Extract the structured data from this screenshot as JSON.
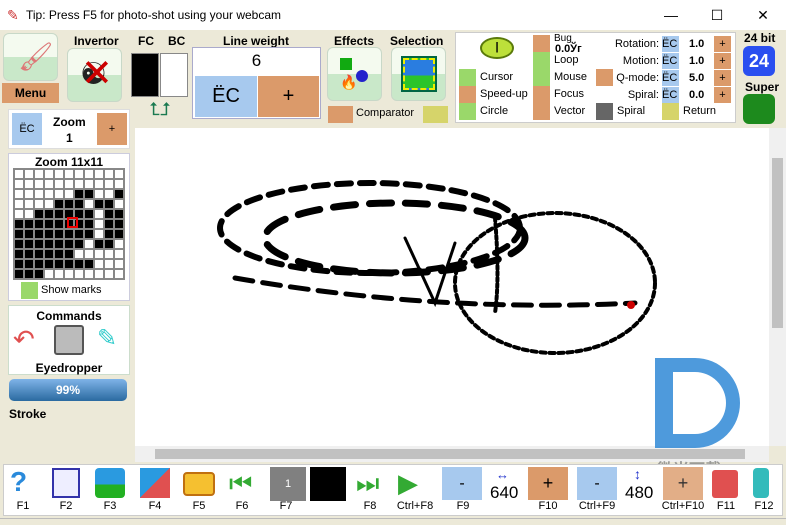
{
  "window": {
    "title": "Tip: Press F5 for photo-shot using your webcam",
    "controls": [
      "—",
      "☐",
      "✕"
    ]
  },
  "toolbar": {
    "menu": "Menu",
    "invertor": "Invertor",
    "fc": "FC",
    "bc": "BC",
    "line_weight": {
      "label": "Line weight",
      "value": "6",
      "minus": "ЁС",
      "plus": "+"
    },
    "effects": "Effects",
    "selection": "Selection",
    "comparator": "Comparator",
    "bug": "Bug",
    "bug_value": "0.0Ўг",
    "options": [
      "Cursor",
      "Speed-up",
      "Circle",
      "Loop",
      "Mouse",
      "Focus",
      "Vector",
      "Spiral",
      "Return"
    ],
    "params": [
      {
        "label": "Rotation:",
        "minus": "ЁС",
        "value": "1.0",
        "plus": "+"
      },
      {
        "label": "Motion:",
        "minus": "ЁС",
        "value": "1.0",
        "plus": "+"
      },
      {
        "label": "Q-mode:",
        "minus": "ЁС",
        "value": "5.0",
        "plus": "+"
      },
      {
        "label": "Spiral:",
        "minus": "ЁС",
        "value": "0.0",
        "plus": "+"
      }
    ],
    "bits": "24 bit",
    "bits_icon": "24",
    "super": "Super"
  },
  "left": {
    "zoom": {
      "minus": "ЁС",
      "label": "Zoom",
      "value": "1",
      "plus": "+"
    },
    "zoom_grid": {
      "title": "Zoom 11x11",
      "rows": [
        "00000000000",
        "00000000000",
        "00000011001",
        "00001110110",
        "00111111011",
        "11111111011",
        "11111111011",
        "11111110110",
        "11111100000",
        "11111111000",
        "11100000000"
      ],
      "show_marks": "Show marks"
    },
    "commands": {
      "title": "Commands",
      "current": "Eyedropper"
    },
    "progress": {
      "value": "99%",
      "fraction": 0.99
    },
    "mode": "Stroke"
  },
  "bottom": {
    "keys": [
      "F1",
      "F2",
      "F3",
      "F4",
      "F5",
      "F6",
      "F7",
      "F8",
      "Ctrl+F8",
      "F9",
      "F10",
      "Ctrl+F9",
      "Ctrl+F10",
      "F11",
      "F12"
    ],
    "f7_value": "1",
    "width": "640",
    "height": "480",
    "minus": "-",
    "plus": "+"
  },
  "watermark": {
    "text": "微当下载",
    "url": "WWW.WEIDOWN.COM"
  }
}
